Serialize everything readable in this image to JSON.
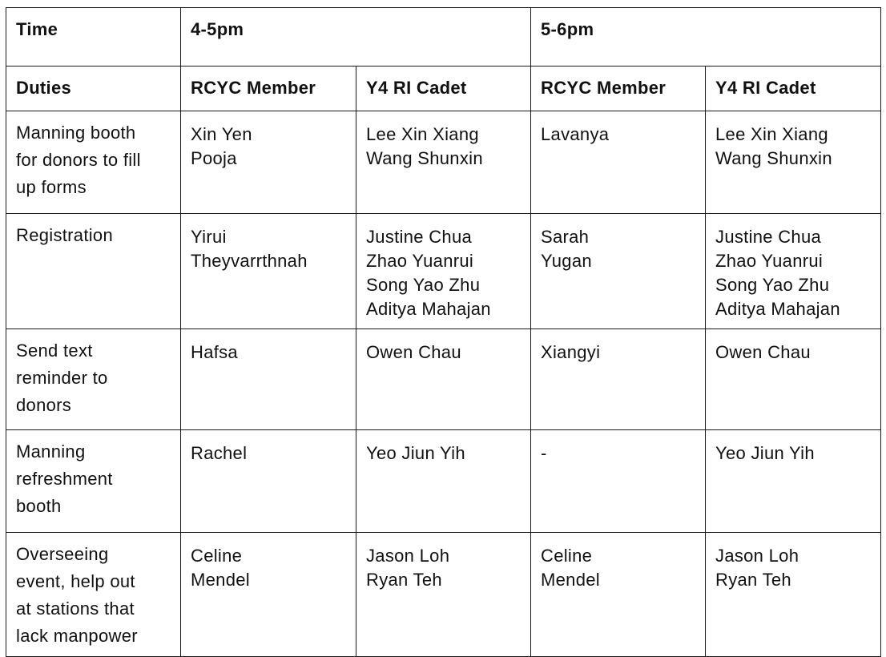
{
  "header": {
    "time_label": "Time",
    "slot1": "4-5pm",
    "slot2": "5-6pm"
  },
  "subheader": {
    "duties_label": "Duties",
    "col_rcyc_1": "RCYC Member",
    "col_y4_1": "Y4 RI Cadet",
    "col_rcyc_2": "RCYC Member",
    "col_y4_2": "Y4 RI Cadet"
  },
  "rows": [
    {
      "duty": [
        "Manning booth",
        "for donors to fill",
        "up forms"
      ],
      "rcyc1": [
        "Xin Yen",
        "Pooja"
      ],
      "y41": [
        "Lee Xin Xiang",
        "Wang Shunxin"
      ],
      "rcyc2": [
        "Lavanya"
      ],
      "y42": [
        "Lee Xin Xiang",
        "Wang Shunxin"
      ]
    },
    {
      "duty": [
        "Registration"
      ],
      "rcyc1": [
        "Yirui",
        "Theyvarrthnah"
      ],
      "y41": [
        "Justine Chua",
        "Zhao Yuanrui",
        "Song Yao Zhu",
        "Aditya Mahajan"
      ],
      "rcyc2": [
        "Sarah",
        "Yugan"
      ],
      "y42": [
        "Justine Chua",
        "Zhao Yuanrui",
        "Song Yao Zhu",
        "Aditya Mahajan"
      ]
    },
    {
      "duty": [
        "Send text",
        "reminder to",
        "donors"
      ],
      "rcyc1": [
        "Hafsa"
      ],
      "y41": [
        "Owen Chau"
      ],
      "rcyc2": [
        "Xiangyi"
      ],
      "y42": [
        "Owen Chau"
      ]
    },
    {
      "duty": [
        "Manning",
        "refreshment",
        "booth"
      ],
      "rcyc1": [
        "Rachel"
      ],
      "y41": [
        "Yeo Jiun Yih"
      ],
      "rcyc2": [
        "-"
      ],
      "y42": [
        "Yeo Jiun Yih"
      ]
    },
    {
      "duty": [
        "Overseeing",
        "event, help out",
        "at stations that",
        "lack manpower"
      ],
      "rcyc1": [
        "Celine",
        "Mendel"
      ],
      "y41": [
        "Jason Loh",
        "Ryan Teh"
      ],
      "rcyc2": [
        "Celine",
        "Mendel"
      ],
      "y42": [
        "Jason Loh",
        "Ryan Teh"
      ]
    }
  ]
}
